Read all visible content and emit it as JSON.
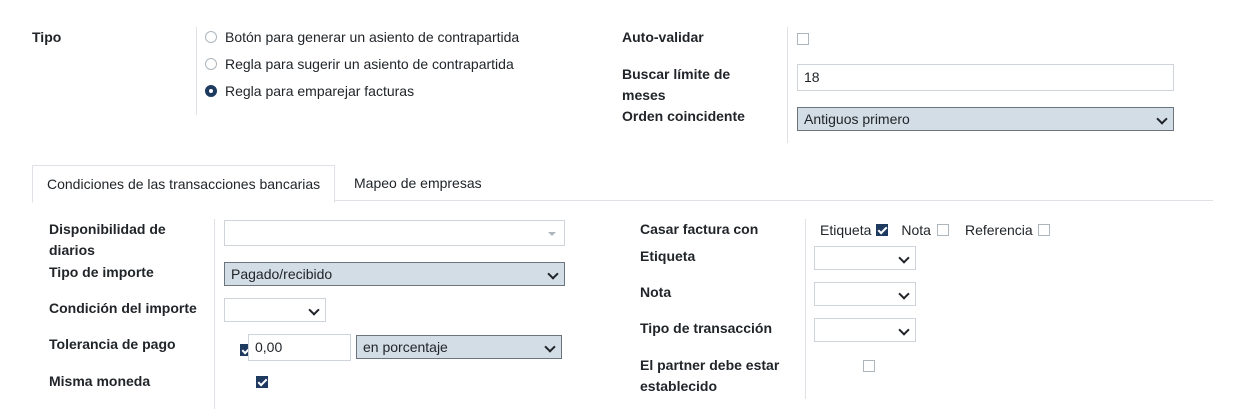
{
  "tipo": {
    "label": "Tipo",
    "options": [
      {
        "label": "Botón para generar un asiento de contrapartida",
        "selected": false
      },
      {
        "label": "Regla para sugerir un asiento de contrapartida",
        "selected": false
      },
      {
        "label": "Regla para emparejar facturas",
        "selected": true
      }
    ]
  },
  "auto_validar": {
    "label": "Auto-validar",
    "checked": false
  },
  "buscar_limite": {
    "label": "Buscar límite de meses",
    "value": "18"
  },
  "orden": {
    "label": "Orden coincidente",
    "value": "Antiguos primero"
  },
  "tabs": [
    {
      "label": "Condiciones de las transacciones bancarias",
      "active": true
    },
    {
      "label": "Mapeo de empresas",
      "active": false
    }
  ],
  "left": {
    "disponibilidad": {
      "label": "Disponibilidad de diarios",
      "value": ""
    },
    "tipo_importe": {
      "label": "Tipo de importe",
      "value": "Pagado/recibido"
    },
    "condicion_importe": {
      "label": "Condición del importe",
      "value": ""
    },
    "tolerancia": {
      "label": "Tolerancia de pago",
      "checked": true,
      "amount": "0,00",
      "unit": "en porcentaje"
    },
    "misma_moneda": {
      "label": "Misma moneda",
      "checked": true
    }
  },
  "right": {
    "casar": {
      "label": "Casar factura con",
      "options": [
        {
          "label": "Etiqueta",
          "checked": true
        },
        {
          "label": "Nota",
          "checked": false
        },
        {
          "label": "Referencia",
          "checked": false
        }
      ]
    },
    "etiqueta": {
      "label": "Etiqueta",
      "value": ""
    },
    "nota": {
      "label": "Nota",
      "value": ""
    },
    "tipo_transaccion": {
      "label": "Tipo de transacción",
      "value": ""
    },
    "partner": {
      "label": "El partner debe estar establecido",
      "checked": false
    }
  },
  "colors": {
    "accent": "#1f3a5f",
    "select_fill": "#d3dde6",
    "divider": "#dee2e6"
  }
}
